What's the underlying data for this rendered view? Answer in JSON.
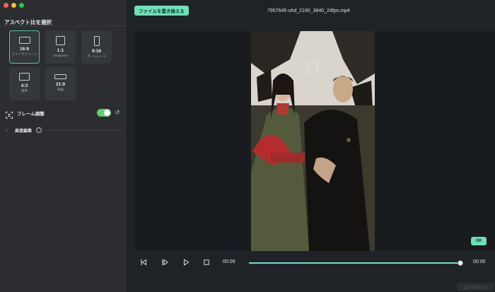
{
  "window": {
    "title": "7957645-uhd_2160_3840_24fps.mp4"
  },
  "sidebar": {
    "aspect_title": "アスペクト比を選択",
    "ratios": [
      {
        "value": "16:9",
        "sub": "ワイドスクリーン",
        "selected": true
      },
      {
        "value": "1:1",
        "sub": "Instagram",
        "selected": false
      },
      {
        "value": "9:16",
        "sub": "ポートレート",
        "selected": false
      },
      {
        "value": "4:3",
        "sub": "標準",
        "selected": false
      },
      {
        "value": "21:9",
        "sub": "映画",
        "selected": false
      }
    ],
    "frame_adjust_label": "フレーム調整",
    "frame_adjust_on": true,
    "advanced_label": "高度編集",
    "info_glyph": "!"
  },
  "toolbar": {
    "replace_file_label": "ファイルを置き換える"
  },
  "preview": {
    "ok_label": "OK"
  },
  "player": {
    "current_time": "00:09",
    "end_time": "00:00",
    "progress": 0.99
  },
  "footer": {
    "export_label": "エクスポート"
  },
  "colors": {
    "accent": "#6ee0b9",
    "toggle": "#5cd06b"
  }
}
